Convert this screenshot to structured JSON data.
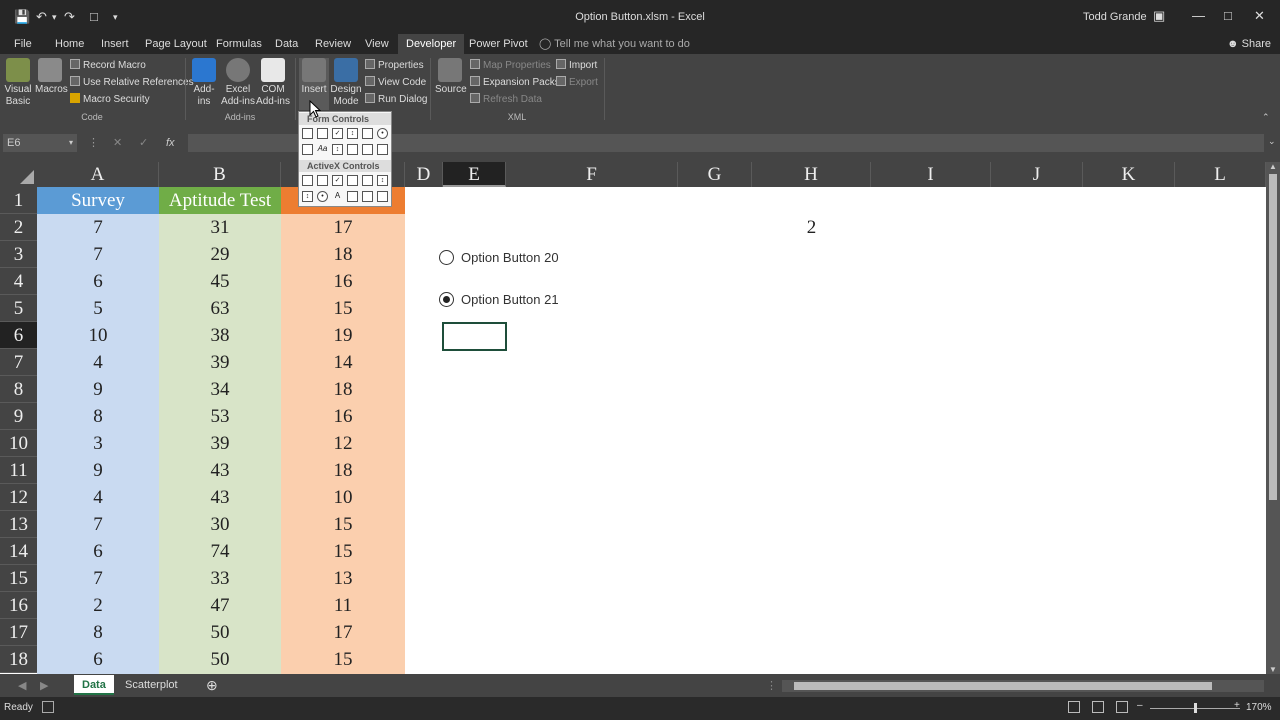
{
  "title_bar": {
    "document_title": "Option Button.xlsm - Excel",
    "user_name": "Todd Grande"
  },
  "ribbon_tabs": [
    "File",
    "Home",
    "Insert",
    "Page Layout",
    "Formulas",
    "Data",
    "Review",
    "View",
    "Developer",
    "Power Pivot"
  ],
  "active_tab": "Developer",
  "tell_me": "Tell me what you want to do",
  "share": "Share",
  "ribbon": {
    "code_group": {
      "label": "Code",
      "visual_basic": [
        "Visual",
        "Basic"
      ],
      "macros": "Macros",
      "record_macro": "Record Macro",
      "use_relative": "Use Relative References",
      "macro_security": "Macro Security"
    },
    "addins_group": {
      "label": "Add-ins",
      "add_ins": [
        "Add-",
        "ins"
      ],
      "excel_add_ins": [
        "Excel",
        "Add-ins"
      ],
      "com_add_ins": [
        "COM",
        "Add-ins"
      ]
    },
    "controls_group": {
      "insert": "Insert",
      "design_mode": [
        "Design",
        "Mode"
      ],
      "properties": "Properties",
      "view_code": "View Code",
      "run_dialog": "Run Dialog"
    },
    "xml_group": {
      "label": "XML",
      "source": "Source",
      "map_properties": "Map Properties",
      "expansion_packs": "Expansion Packs",
      "refresh_data": "Refresh Data",
      "import": "Import",
      "export": "Export"
    }
  },
  "insert_dropdown": {
    "form_controls": "Form Controls",
    "activex_controls": "ActiveX Controls"
  },
  "name_box": "E6",
  "fx": "fx",
  "columns": [
    "A",
    "B",
    "C",
    "D",
    "E",
    "F",
    "G",
    "H",
    "I",
    "J",
    "K",
    "L"
  ],
  "selected_column": "E",
  "selected_row": "6",
  "rows": [
    "1",
    "2",
    "3",
    "4",
    "5",
    "6",
    "7",
    "8",
    "9",
    "10",
    "11",
    "12",
    "13",
    "14",
    "15",
    "16",
    "17",
    "18"
  ],
  "headers": {
    "a": "Survey",
    "b": "Aptitude Test"
  },
  "column_a": [
    "7",
    "7",
    "6",
    "5",
    "10",
    "4",
    "9",
    "8",
    "3",
    "9",
    "4",
    "7",
    "6",
    "7",
    "2",
    "8",
    "6"
  ],
  "column_b": [
    "31",
    "29",
    "45",
    "63",
    "38",
    "39",
    "34",
    "53",
    "39",
    "43",
    "43",
    "30",
    "74",
    "33",
    "47",
    "50",
    "50"
  ],
  "column_c": [
    "17",
    "18",
    "16",
    "15",
    "19",
    "14",
    "18",
    "16",
    "12",
    "18",
    "10",
    "15",
    "15",
    "13",
    "11",
    "17",
    "15"
  ],
  "h2_value": "2",
  "option_buttons": [
    {
      "label": "Option Button 20",
      "selected": false
    },
    {
      "label": "Option Button 21",
      "selected": true
    }
  ],
  "sheet_tabs": [
    "Data",
    "Scatterplot"
  ],
  "active_sheet": "Data",
  "status": {
    "ready": "Ready",
    "zoom": "170%"
  },
  "colors": {
    "survey_header": "#5b9bd5",
    "survey_fill": "#c9daf1",
    "aptitude_header": "#70ad47",
    "aptitude_fill": "#d8e4c8",
    "c_header": "#ed7d31",
    "c_fill": "#fbcfae"
  }
}
